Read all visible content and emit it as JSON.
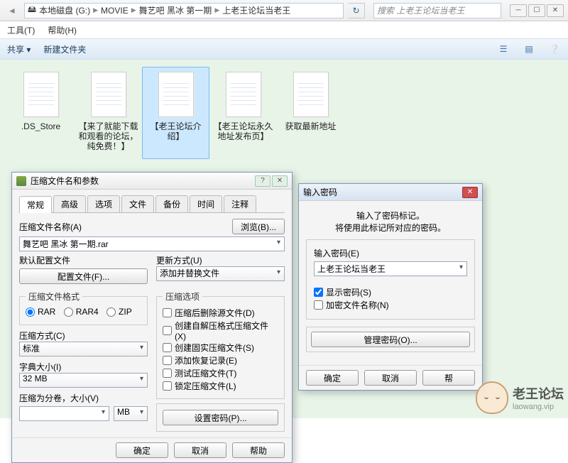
{
  "breadcrumb": {
    "drive": "本地磁盘 (G:)",
    "p1": "MOVIE",
    "p2": "舞艺吧 黑冰 第一期",
    "p3": "上老王论坛当老王"
  },
  "search_placeholder": "搜索 上老王论坛当老王",
  "menu": {
    "tools": "工具(T)",
    "help": "帮助(H)"
  },
  "toolbar": {
    "share": "共享 ▾",
    "newfolder": "新建文件夹"
  },
  "files": [
    {
      "name": ".DS_Store"
    },
    {
      "name": "【来了就能下载和观看的论坛，纯免费！】"
    },
    {
      "name": "【老王论坛介绍】",
      "selected": true
    },
    {
      "name": "【老王论坛永久地址发布页】"
    },
    {
      "name": "获取最新地址"
    }
  ],
  "rar": {
    "title": "压缩文件名和参数",
    "tabs": [
      "常规",
      "高级",
      "选项",
      "文件",
      "备份",
      "时间",
      "注释"
    ],
    "name_lbl": "压缩文件名称(A)",
    "browse": "浏览(B)...",
    "name_val": "舞艺吧 黑冰 第一期.rar",
    "profile_lbl": "默认配置文件",
    "profile_btn": "配置文件(F)...",
    "update_lbl": "更新方式(U)",
    "update_val": "添加并替换文件",
    "fmt_lbl": "压缩文件格式",
    "fmt_rar": "RAR",
    "fmt_rar4": "RAR4",
    "fmt_zip": "ZIP",
    "opts_lbl": "压缩选项",
    "opt1": "压缩后删除源文件(D)",
    "opt2": "创建自解压格式压缩文件(X)",
    "opt3": "创建固实压缩文件(S)",
    "opt4": "添加恢复记录(E)",
    "opt5": "测试压缩文件(T)",
    "opt6": "锁定压缩文件(L)",
    "method_lbl": "压缩方式(C)",
    "method_val": "标准",
    "dict_lbl": "字典大小(I)",
    "dict_val": "32 MB",
    "split_lbl": "压缩为分卷，大小(V)",
    "split_unit": "MB",
    "setpwd": "设置密码(P)...",
    "ok": "确定",
    "cancel": "取消",
    "help": "帮助"
  },
  "pwd": {
    "title": "输入密码",
    "line1": "输入了密码标记。",
    "line2": "将使用此标记所对应的密码。",
    "lbl": "输入密码(E)",
    "val": "上老王论坛当老王",
    "show": "显示密码(S)",
    "encname": "加密文件名称(N)",
    "manage": "管理密码(O)...",
    "ok": "确定",
    "cancel": "取消",
    "help": "帮"
  },
  "watermark": {
    "t1": "老王论坛",
    "t2": "laowang.vip"
  }
}
